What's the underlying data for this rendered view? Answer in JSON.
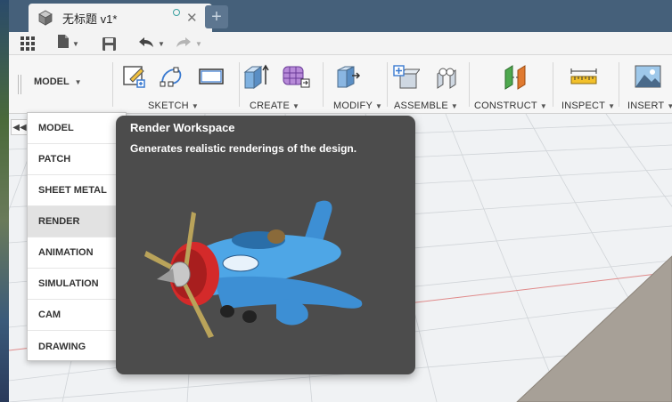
{
  "document": {
    "title": "无标题 v1*"
  },
  "ribbon": {
    "workspace_label": "MODEL",
    "groups": [
      {
        "label": "SKETCH"
      },
      {
        "label": "CREATE"
      },
      {
        "label": "MODIFY"
      },
      {
        "label": "ASSEMBLE"
      },
      {
        "label": "CONSTRUCT"
      },
      {
        "label": "INSPECT"
      },
      {
        "label": "INSERT"
      }
    ]
  },
  "workspace_menu": {
    "items": [
      {
        "label": "MODEL"
      },
      {
        "label": "PATCH"
      },
      {
        "label": "SHEET METAL"
      },
      {
        "label": "RENDER"
      },
      {
        "label": "ANIMATION"
      },
      {
        "label": "SIMULATION"
      },
      {
        "label": "CAM"
      },
      {
        "label": "DRAWING"
      }
    ],
    "highlighted": "RENDER"
  },
  "tooltip": {
    "title": "Render Workspace",
    "description": "Generates realistic renderings of the design.",
    "image_icon": "toy-airplane-render"
  },
  "icons": {
    "app": "cube-icon",
    "grid": "app-grid-icon",
    "file": "file-icon",
    "save": "save-icon",
    "undo": "undo-icon",
    "redo": "redo-icon"
  },
  "colors": {
    "titlebar": "#45607a",
    "tooltip_bg": "#4c4c4c",
    "airplane_body": "#4ea6e6",
    "airplane_cowl": "#d42a2a"
  }
}
